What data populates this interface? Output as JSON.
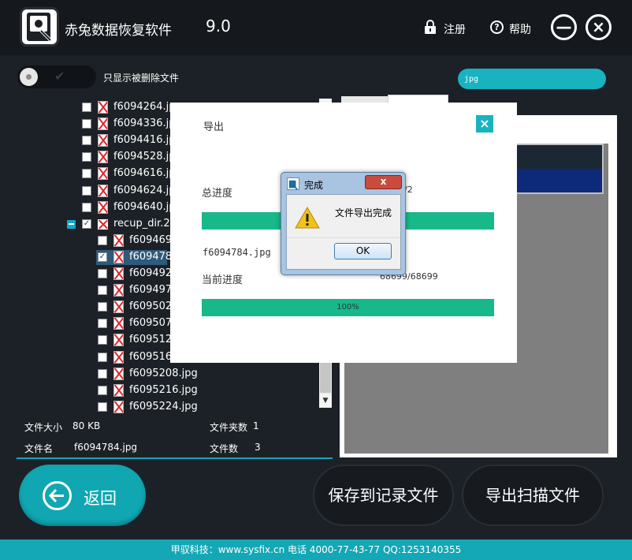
{
  "header": {
    "app_title": "赤兔数据恢复软件",
    "version": "9.0",
    "register_label": "注册",
    "help_label": "帮助",
    "minimize_symbol": "—",
    "close_symbol": "×"
  },
  "toolbar": {
    "filter_label": "只显示被删除文件",
    "filter_enabled": false,
    "extension_value": "jpg"
  },
  "tree": {
    "items": [
      {
        "label": "f6094264.jpg",
        "checked": false
      },
      {
        "label": "f6094336.jpg",
        "checked": false
      },
      {
        "label": "f6094416.jpg",
        "checked": false
      },
      {
        "label": "f6094528.jpg",
        "checked": false
      },
      {
        "label": "f6094616.jpg",
        "checked": false
      },
      {
        "label": "f6094624.jpg",
        "checked": false
      },
      {
        "label": "f6094640.jpg",
        "checked": false
      },
      {
        "label": "recup_dir.22",
        "checked": true,
        "type": "folder"
      },
      {
        "label": "f609469",
        "checked": false
      },
      {
        "label": "f609478",
        "checked": true,
        "selected": true
      },
      {
        "label": "f609492",
        "checked": false
      },
      {
        "label": "f609497",
        "checked": false
      },
      {
        "label": "f609502",
        "checked": false
      },
      {
        "label": "f609507",
        "checked": false
      },
      {
        "label": "f609512",
        "checked": false
      },
      {
        "label": "f609516",
        "checked": false
      },
      {
        "label": "f6095208.jpg",
        "checked": false
      },
      {
        "label": "f6095216.jpg",
        "checked": false
      },
      {
        "label": "f6095224.jpg",
        "checked": false
      }
    ]
  },
  "info": {
    "size_label": "文件大小",
    "size_value": "80 KB",
    "folder_count_label": "文件夹数",
    "folder_count_value": "1",
    "name_label": "文件名",
    "name_value": "f6094784.jpg",
    "file_count_label": "文件数",
    "file_count_value": "3"
  },
  "export_dialog": {
    "title": "导出",
    "close_symbol": "×",
    "total_label": "总进度",
    "total_count_visible": "/2",
    "total_progress": 1.0,
    "current_file": "f6094784.jpg",
    "current_label": "当前进度",
    "current_count": "68699/68699",
    "current_progress": 1.0,
    "current_percent": "100%"
  },
  "done_dialog": {
    "title": "完成",
    "message": "文件导出完成",
    "ok_label": "OK",
    "close_symbol": "x"
  },
  "buttons": {
    "back_label": "返回",
    "save_label": "保存到记录文件",
    "export_scan_label": "导出扫描文件"
  },
  "footer": {
    "text": "甲驭科技：www.sysfix.cn 电话 4000-77-43-77 QQ:1253140355"
  },
  "colors": {
    "accent": "#14a7b5",
    "progress": "#17b88a",
    "background": "#1c2127"
  }
}
